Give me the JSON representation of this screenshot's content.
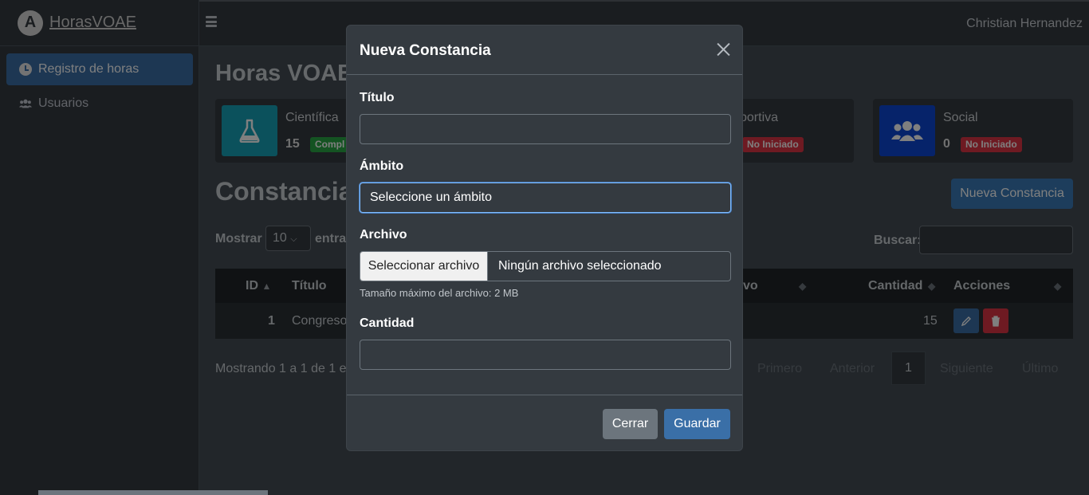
{
  "brand": {
    "name": "HorasVOAE",
    "logo_letter": "A"
  },
  "header": {
    "user": "Christian Hernandez"
  },
  "sidebar": {
    "items": [
      {
        "label": "Registro de horas",
        "icon": "clock-icon",
        "active": true
      },
      {
        "label": "Usuarios",
        "icon": "users-icon",
        "active": false
      }
    ]
  },
  "main": {
    "title": "Horas VOAE",
    "cards": [
      {
        "label": "Científica",
        "count": "15",
        "badge": "Compl",
        "color": "#17a2b8",
        "icon": "flask-icon"
      },
      {
        "label": "portiva",
        "count": "",
        "badge": "No Iniciado",
        "color": "#343a40",
        "icon": ""
      },
      {
        "label": "Social",
        "count": "0",
        "badge": "No Iniciado",
        "color": "#0d47d4",
        "icon": "users-icon"
      }
    ],
    "section_title": "Constancias",
    "new_button": "Nueva Constancia",
    "show_label": "Mostrar",
    "show_value": "10",
    "show_suffix": "entra",
    "search_label": "Buscar:",
    "table": {
      "headers": [
        "ID",
        "Título",
        "vo",
        "Cantidad",
        "Acciones"
      ],
      "rows": [
        {
          "id": "1",
          "titulo": "Congreso",
          "cantidad": "15"
        }
      ]
    },
    "footer_info": "Mostrando 1 a 1 de 1 e",
    "pager": {
      "first": "Primero",
      "prev": "Anterior",
      "current": "1",
      "next": "Siguiente",
      "last": "Último"
    }
  },
  "modal": {
    "title": "Nueva Constancia",
    "fields": {
      "titulo_label": "Título",
      "titulo_value": "",
      "ambito_label": "Ámbito",
      "ambito_value": "Seleccione un ámbito",
      "archivo_label": "Archivo",
      "archivo_button": "Seleccionar archivo",
      "archivo_status": "Ningún archivo seleccionado",
      "archivo_help": "Tamaño máximo del archivo: 2 MB",
      "cantidad_label": "Cantidad",
      "cantidad_value": ""
    },
    "close_button": "Cerrar",
    "save_button": "Guardar"
  }
}
